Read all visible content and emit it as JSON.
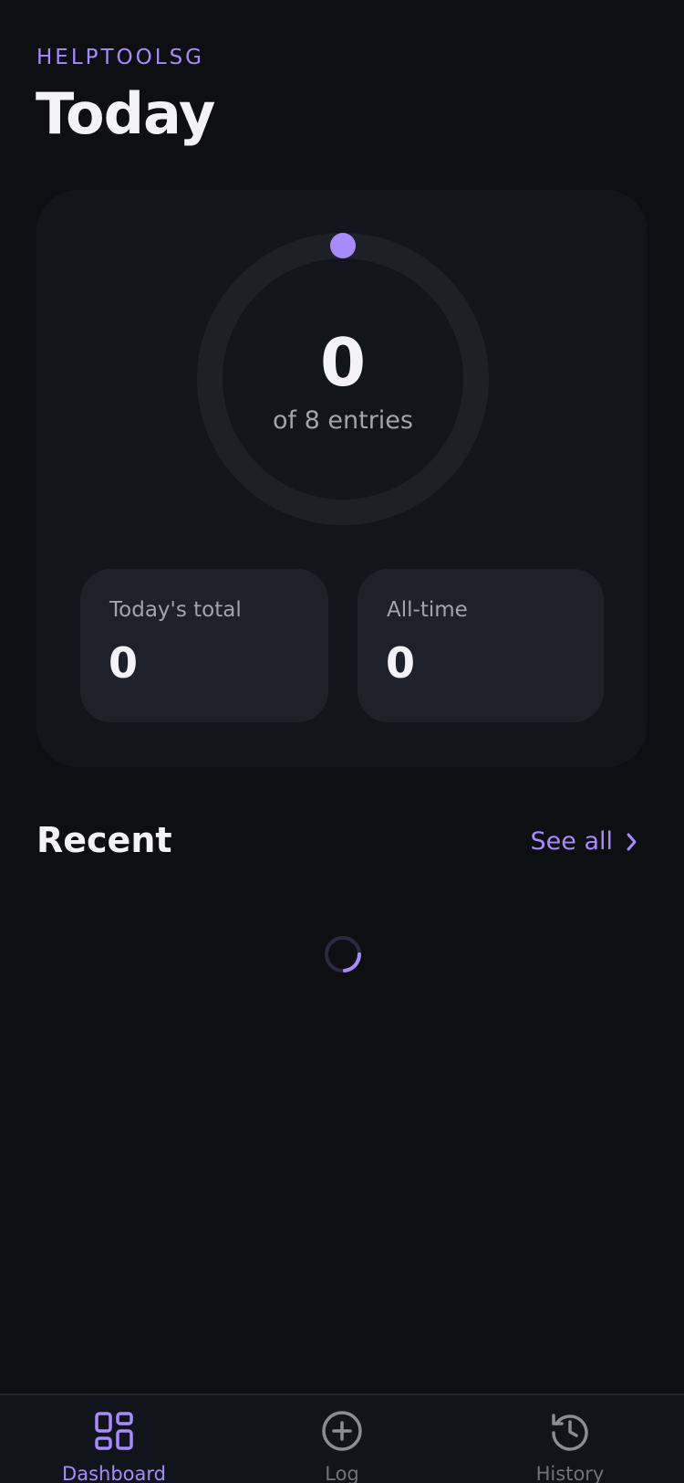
{
  "header": {
    "brand": "HELPTOOLSG",
    "title": "Today"
  },
  "progress": {
    "count": "0",
    "subtitle": "of 8 entries",
    "fraction": 0
  },
  "stats": [
    {
      "label": "Today's total",
      "value": "0"
    },
    {
      "label": "All-time",
      "value": "0"
    }
  ],
  "recent": {
    "title": "Recent",
    "see_all_label": "See all"
  },
  "tabs": [
    {
      "label": "Dashboard",
      "icon": "dashboard-icon",
      "active": true
    },
    {
      "label": "Log",
      "icon": "plus-circle-icon",
      "active": false
    },
    {
      "label": "History",
      "icon": "history-icon",
      "active": false
    }
  ],
  "colors": {
    "accent": "#a78bfa",
    "background": "#0e0f13",
    "card": "#13151c",
    "tile": "#1f212a"
  }
}
